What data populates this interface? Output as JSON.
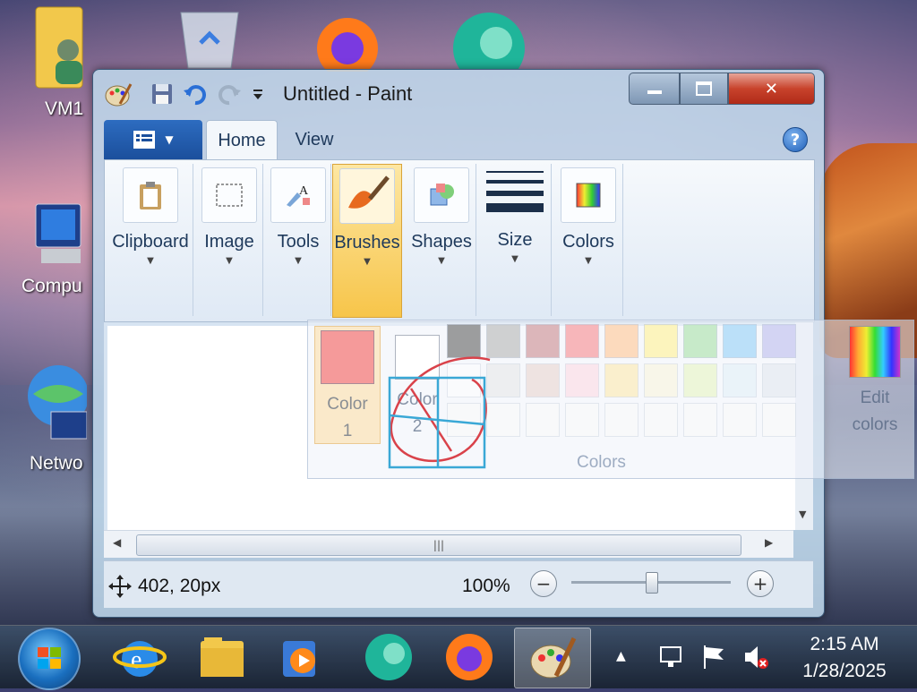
{
  "window": {
    "title": "Untitled - Paint",
    "tabs": [
      "Home",
      "View"
    ],
    "groups": [
      "Clipboard",
      "Image",
      "Tools",
      "Brushes",
      "Shapes",
      "Size",
      "Colors"
    ],
    "active_group": "Brushes"
  },
  "colors_panel": {
    "color1_label": "Color 1",
    "color2_label": "Color 2",
    "edit_label": "Edit colors",
    "group_label": "Colors",
    "color1_value": "#f59a9a",
    "color2_value": "#ffffff"
  },
  "status": {
    "coords": "402, 20px",
    "zoom": "100%",
    "zoom_level": 0.5
  },
  "desktop_icons": [
    "VM1",
    "Compu",
    "Netwo"
  ],
  "taskbar": {
    "time": "2:15 AM",
    "date": "1/28/2025",
    "apps": [
      "internet-explorer",
      "file-explorer",
      "media-player",
      "edge",
      "firefox",
      "paint"
    ]
  }
}
